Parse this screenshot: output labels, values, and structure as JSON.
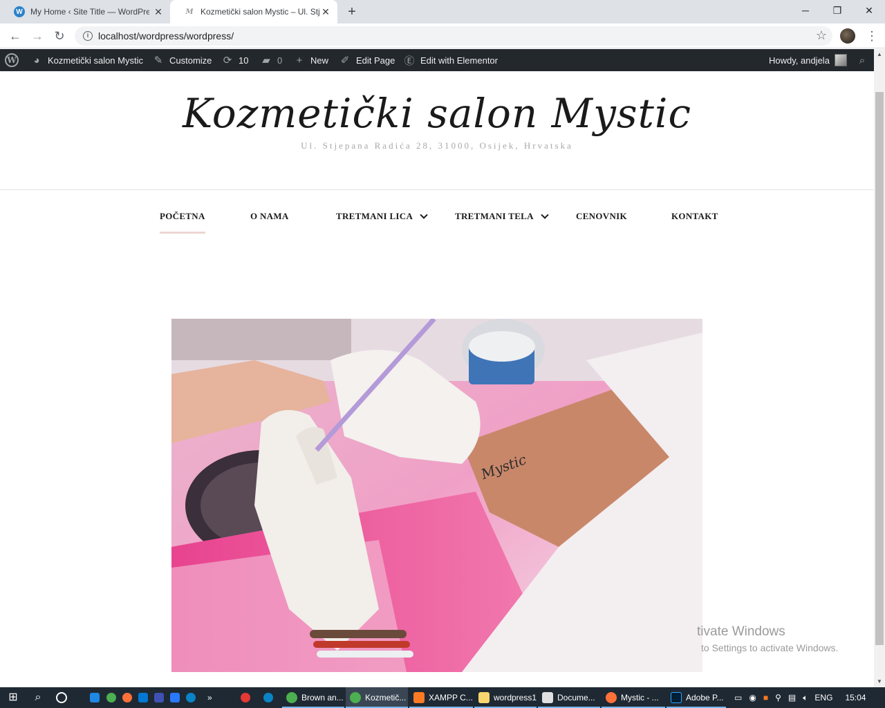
{
  "browser": {
    "tabs": [
      {
        "title": "My Home ‹ Site Title — WordPress",
        "favicon": "W"
      },
      {
        "title": "Kozmetički salon Mystic – Ul. Stjepana Radića",
        "favicon": "M"
      }
    ],
    "url": "localhost/wordpress/wordpress/"
  },
  "adminbar": {
    "site_name": "Kozmetički salon Mystic",
    "customize": "Customize",
    "updates": "10",
    "comments": "0",
    "new": "New",
    "edit_page": "Edit Page",
    "edit_elementor": "Edit with Elementor",
    "howdy": "Howdy, andjela"
  },
  "site": {
    "title": "Kozmetički salon Mystic",
    "description": "Ul. Stjepana Radića 28, 31000, Osijek, Hrvatska"
  },
  "nav": [
    {
      "label": "POČETNA",
      "active": true
    },
    {
      "label": "O NAMA"
    },
    {
      "label": "TRETMANI LICA",
      "dropdown": true
    },
    {
      "label": "TRETMANI TELA",
      "dropdown": true
    },
    {
      "label": "CENOVNIK"
    },
    {
      "label": "KONTAKT"
    }
  ],
  "watermark": {
    "line1": "tivate Windows",
    "line2": "to Settings to activate Windows."
  },
  "taskbar": {
    "apps": [
      "Brown an...",
      "Kozmetič...",
      "XAMPP C...",
      "wordpress1",
      "Docume...",
      "Mystic - ...",
      "Adobe P..."
    ],
    "lang": "ENG",
    "time": "15:04"
  },
  "colors": {
    "adminbar_bg": "#23282d",
    "nav_active_underline": "#ecd6d3",
    "taskbar_bg": "#1f2933"
  }
}
